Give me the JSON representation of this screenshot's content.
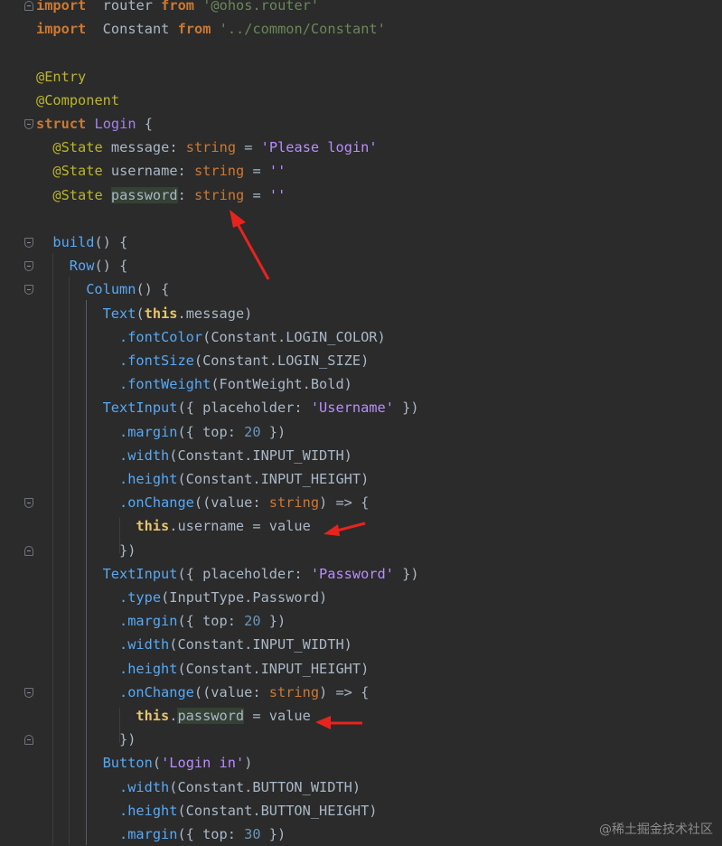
{
  "editor": {
    "lines": [
      [
        [
          "kw",
          "import"
        ],
        [
          "",
          "  router "
        ],
        [
          "kw",
          "from"
        ],
        [
          "",
          ""
        ],
        [
          "str",
          " '@ohos.router'"
        ]
      ],
      [
        [
          "kw",
          "import"
        ],
        [
          "",
          "  Constant "
        ],
        [
          "kw",
          "from"
        ],
        [
          "str",
          " '../common/Constant'"
        ]
      ],
      [],
      [
        [
          "an",
          "@Entry"
        ]
      ],
      [
        [
          "an",
          "@Component"
        ]
      ],
      [
        [
          "kw",
          "struct"
        ],
        [
          "",
          " "
        ],
        [
          "st",
          "Login"
        ],
        [
          "",
          " {"
        ]
      ],
      [
        [
          "",
          ""
        ],
        [
          "an",
          "@State"
        ],
        [
          "",
          " message: "
        ],
        [
          "ty",
          "string"
        ],
        [
          "",
          " = "
        ],
        [
          "sq",
          "'Please login'"
        ]
      ],
      [
        [
          "",
          ""
        ],
        [
          "an",
          "@State"
        ],
        [
          "",
          " username: "
        ],
        [
          "ty",
          "string"
        ],
        [
          "",
          " = "
        ],
        [
          "sq",
          "''"
        ]
      ],
      [
        [
          "",
          ""
        ],
        [
          "an",
          "@State"
        ],
        [
          "",
          " "
        ],
        [
          "hl",
          "password"
        ],
        [
          "",
          ": "
        ],
        [
          "ty",
          "string"
        ],
        [
          "",
          " = "
        ],
        [
          "sq",
          "''"
        ]
      ],
      [],
      [
        [
          "fn",
          "build"
        ],
        [
          "",
          "() {"
        ]
      ],
      [
        [
          "fn",
          "Row"
        ],
        [
          "",
          "() {"
        ]
      ],
      [
        [
          "fn",
          "Column"
        ],
        [
          "",
          "() {"
        ]
      ],
      [
        [
          "fn",
          "Text"
        ],
        [
          "",
          "("
        ],
        [
          "th",
          "this"
        ],
        [
          "",
          ".message)"
        ]
      ],
      [
        [
          "fn",
          ".fontColor"
        ],
        [
          "",
          "(Constant.LOGIN_COLOR)"
        ]
      ],
      [
        [
          "fn",
          ".fontSize"
        ],
        [
          "",
          "(Constant.LOGIN_SIZE)"
        ]
      ],
      [
        [
          "fn",
          ".fontWeight"
        ],
        [
          "",
          "(FontWeight.Bold)"
        ]
      ],
      [
        [
          "fn",
          "TextInput"
        ],
        [
          "",
          "({ placeholder: "
        ],
        [
          "sq",
          "'Username'"
        ],
        [
          "",
          " })"
        ]
      ],
      [
        [
          "fn",
          ".margin"
        ],
        [
          "",
          "({ top: "
        ],
        [
          "num",
          "20"
        ],
        [
          "",
          " })"
        ]
      ],
      [
        [
          "fn",
          ".width"
        ],
        [
          "",
          "(Constant.INPUT_WIDTH)"
        ]
      ],
      [
        [
          "fn",
          ".height"
        ],
        [
          "",
          "(Constant.INPUT_HEIGHT)"
        ]
      ],
      [
        [
          "fn",
          ".onChange"
        ],
        [
          "",
          "((value: "
        ],
        [
          "ty",
          "string"
        ],
        [
          "",
          ") => {"
        ]
      ],
      [
        [
          "th",
          "this"
        ],
        [
          "",
          ".username = value"
        ]
      ],
      [
        [
          "",
          "})"
        ]
      ],
      [
        [
          "fn",
          "TextInput"
        ],
        [
          "",
          "({ placeholder: "
        ],
        [
          "sq",
          "'Password'"
        ],
        [
          "",
          " })"
        ]
      ],
      [
        [
          "fn",
          ".type"
        ],
        [
          "",
          "(InputType.Password)"
        ]
      ],
      [
        [
          "fn",
          ".margin"
        ],
        [
          "",
          "({ top: "
        ],
        [
          "num",
          "20"
        ],
        [
          "",
          " })"
        ]
      ],
      [
        [
          "fn",
          ".width"
        ],
        [
          "",
          "(Constant.INPUT_WIDTH)"
        ]
      ],
      [
        [
          "fn",
          ".height"
        ],
        [
          "",
          "(Constant.INPUT_HEIGHT)"
        ]
      ],
      [
        [
          "fn",
          ".onChange"
        ],
        [
          "",
          "((value: "
        ],
        [
          "ty",
          "string"
        ],
        [
          "",
          ") => {"
        ]
      ],
      [
        [
          "th",
          "this"
        ],
        [
          "",
          "."
        ],
        [
          "hl",
          "password"
        ],
        [
          "",
          " = value"
        ]
      ],
      [
        [
          "",
          "})"
        ]
      ],
      [
        [
          "fn",
          "Button"
        ],
        [
          "",
          "("
        ],
        [
          "sq",
          "'Login in'"
        ],
        [
          "",
          ")"
        ]
      ],
      [
        [
          "fn",
          ".width"
        ],
        [
          "",
          "(Constant.BUTTON_WIDTH)"
        ]
      ],
      [
        [
          "fn",
          ".height"
        ],
        [
          "",
          "(Constant.BUTTON_HEIGHT)"
        ]
      ],
      [
        [
          "fn",
          ".margin"
        ],
        [
          "",
          "({ top: "
        ],
        [
          "num",
          "30"
        ],
        [
          "",
          " })"
        ]
      ]
    ]
  },
  "watermark": "@稀土掘金技术社区",
  "colors": {
    "background": "#2b2b2b",
    "keyword": "#cc7832",
    "annotation": "#bbb529",
    "function": "#56a8f5",
    "string": "#b98dff",
    "number": "#6897bb",
    "this": "#e8c46a",
    "arrow": "#e8231e"
  }
}
